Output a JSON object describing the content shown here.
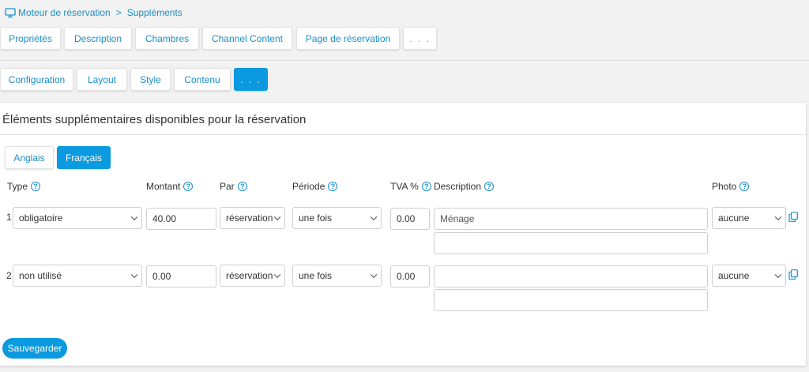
{
  "breadcrumb": {
    "icon": "monitor-icon",
    "items": [
      "Moteur de réservation",
      "Suppléments"
    ],
    "separator": ">"
  },
  "top_tabs": [
    {
      "label": "Propriétés"
    },
    {
      "label": "Description"
    },
    {
      "label": "Chambres"
    },
    {
      "label": "Channel Content"
    },
    {
      "label": "Page de réservation"
    },
    {
      "label": ". . ."
    }
  ],
  "sub_tabs": [
    {
      "label": "Configuration"
    },
    {
      "label": "Layout"
    },
    {
      "label": "Style"
    },
    {
      "label": "Contenu"
    },
    {
      "label": ". . .",
      "active": true
    }
  ],
  "panel": {
    "title": "Éléments supplémentaires disponibles pour la réservation",
    "languages": [
      {
        "label": "Anglais"
      },
      {
        "label": "Français",
        "active": true
      }
    ],
    "columns": {
      "type": "Type",
      "amount": "Montant",
      "per": "Par",
      "period": "Période",
      "vat": "TVA %",
      "description": "Description",
      "photo": "Photo"
    },
    "rows": [
      {
        "num": "1",
        "type": "obligatoire",
        "amount": "40.00",
        "per": "réservation",
        "period": "une fois",
        "vat": "0.00",
        "description": "Ménage",
        "description2": "",
        "photo": "aucune"
      },
      {
        "num": "2",
        "type": "non utilisé",
        "amount": "0.00",
        "per": "réservation",
        "period": "une fois",
        "vat": "0.00",
        "description": "",
        "description2": "",
        "photo": "aucune"
      }
    ],
    "save_label": "Sauvegarder"
  },
  "colors": {
    "accent": "#0b9ae0",
    "link": "#1a8fc9"
  }
}
